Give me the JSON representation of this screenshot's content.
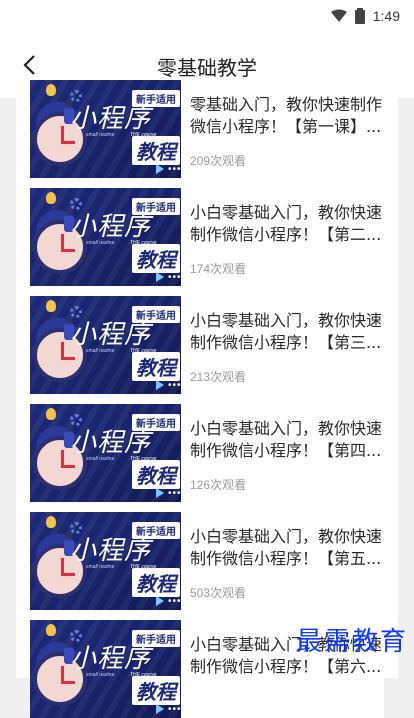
{
  "status_bar": {
    "time": "1:49"
  },
  "header": {
    "title": "零基础教学"
  },
  "thumbnail": {
    "tag": "新手适用",
    "main": "小程序",
    "course": "教程",
    "sub1": "THE course",
    "sub2": "small routine"
  },
  "courses": [
    {
      "title": "零基础入门，教你快速制作微信小程序！【第一课】...",
      "views": "209次观看"
    },
    {
      "title": "小白零基础入门，教你快速制作微信小程序！【第二...",
      "views": "174次观看"
    },
    {
      "title": "小白零基础入门，教你快速制作微信小程序！【第三...",
      "views": "213次观看"
    },
    {
      "title": "小白零基础入门，教你快速制作微信小程序！【第四...",
      "views": "126次观看"
    },
    {
      "title": "小白零基础入门，教你快速制作微信小程序！【第五...",
      "views": "503次观看"
    },
    {
      "title": "小白零基础入门，教你快速制作微信小程序！【第六...",
      "views": ""
    }
  ],
  "watermark": "最需教育",
  "colors": {
    "thumb_bg": "#1e2a78",
    "accent_watermark": "#0b39ff"
  }
}
